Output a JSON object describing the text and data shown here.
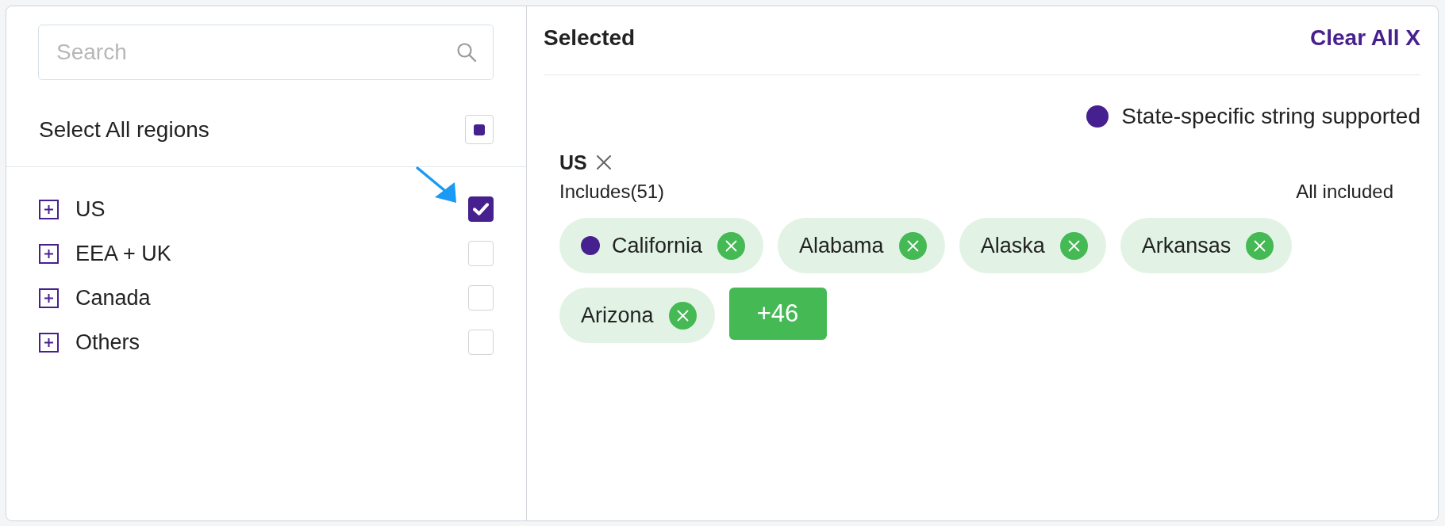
{
  "search": {
    "placeholder": "Search"
  },
  "select_all": {
    "label": "Select All regions",
    "indeterminate": true
  },
  "regions": [
    {
      "label": "US",
      "expanded": false,
      "checked": true
    },
    {
      "label": "EEA + UK",
      "expanded": false,
      "checked": false
    },
    {
      "label": "Canada",
      "expanded": false,
      "checked": false
    },
    {
      "label": "Others",
      "expanded": false,
      "checked": false
    }
  ],
  "selected_panel": {
    "title": "Selected",
    "clear_all": "Clear All X",
    "legend": {
      "label": "State-specific string supported"
    },
    "groups": [
      {
        "name": "US",
        "count": "Includes(51)",
        "status": "All included",
        "chips": [
          {
            "label": "California",
            "state_specific": true
          },
          {
            "label": "Alabama",
            "state_specific": false
          },
          {
            "label": "Alaska",
            "state_specific": false
          },
          {
            "label": "Arkansas",
            "state_specific": false
          },
          {
            "label": "Arizona",
            "state_specific": false
          }
        ],
        "more": "+46"
      }
    ]
  }
}
